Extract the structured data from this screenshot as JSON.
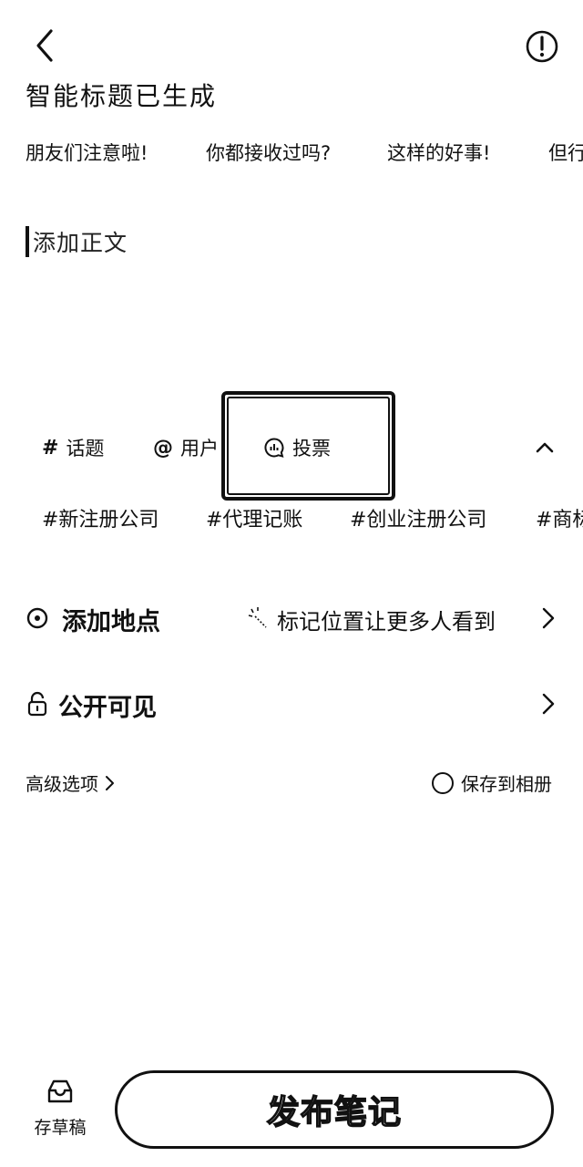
{
  "header": {
    "back_icon": "back-arrow-icon",
    "info_icon": "exclamation-circle-icon"
  },
  "smart_title": {
    "heading": "智能标题已生成",
    "suggestions": [
      "朋友们注意啦!",
      "你都接收过吗?",
      "这样的好事!",
      "但行"
    ]
  },
  "editor": {
    "body_placeholder": "添加正文"
  },
  "toolbar": {
    "topic_label": "话题",
    "user_label": "用户",
    "vote_label": "投票"
  },
  "hashtags": [
    "#新注册公司",
    "#代理记账",
    "#创业注册公司",
    "#商标"
  ],
  "location": {
    "label": "添加地点",
    "hint": "标记位置让更多人看到"
  },
  "visibility": {
    "label": "公开可见"
  },
  "options": {
    "advanced_label": "高级选项",
    "save_album_label": "保存到相册",
    "save_album_checked": false
  },
  "bottom": {
    "draft_label": "存草稿",
    "publish_label": "发布笔记"
  }
}
